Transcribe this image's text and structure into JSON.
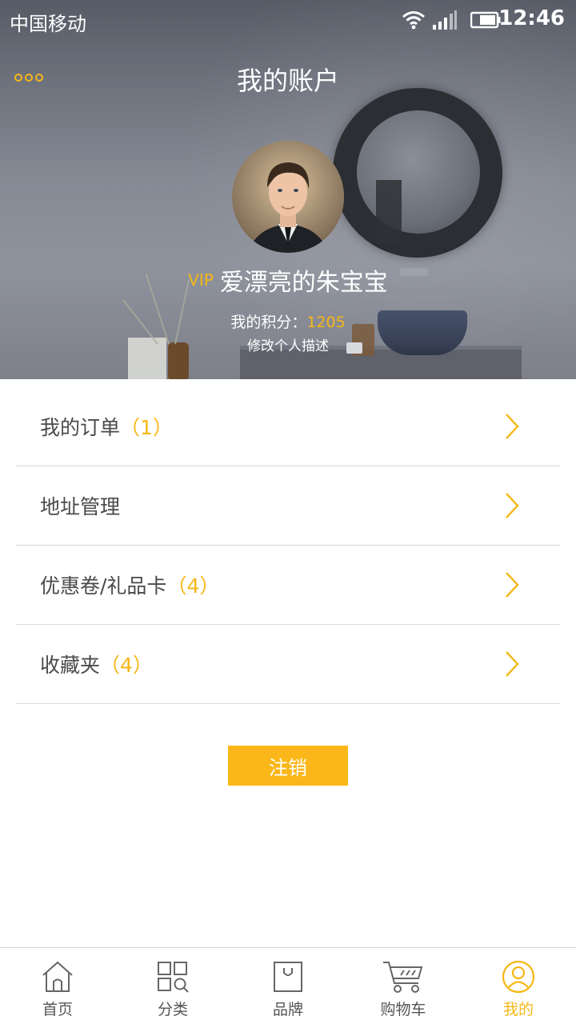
{
  "status_bar": {
    "carrier": "中国移动",
    "time": "12:46"
  },
  "header": {
    "title": "我的账户",
    "more_icon": "more-dots-icon"
  },
  "profile": {
    "vip_label": "VIP",
    "username": "爱漂亮的朱宝宝",
    "points_label": "我的积分：",
    "points_value": "1205",
    "edit_description": "修改个人描述"
  },
  "menu": {
    "items": [
      {
        "label": "我的订单",
        "count": "（1）"
      },
      {
        "label": "地址管理",
        "count": ""
      },
      {
        "label": "优惠卷/礼品卡",
        "count": "（4）"
      },
      {
        "label": "收藏夹",
        "count": "（4）"
      }
    ]
  },
  "logout_label": "注销",
  "tabbar": {
    "tabs": [
      {
        "label": "首页",
        "icon": "home-icon",
        "active": false
      },
      {
        "label": "分类",
        "icon": "category-icon",
        "active": false
      },
      {
        "label": "品牌",
        "icon": "brand-bag-icon",
        "active": false
      },
      {
        "label": "购物车",
        "icon": "cart-icon",
        "active": false
      },
      {
        "label": "我的",
        "icon": "user-icon",
        "active": true
      }
    ]
  },
  "colors": {
    "accent": "#f6b716",
    "button": "#fbb71a",
    "text": "#4a4a4a",
    "divider": "#d6d6d6"
  }
}
